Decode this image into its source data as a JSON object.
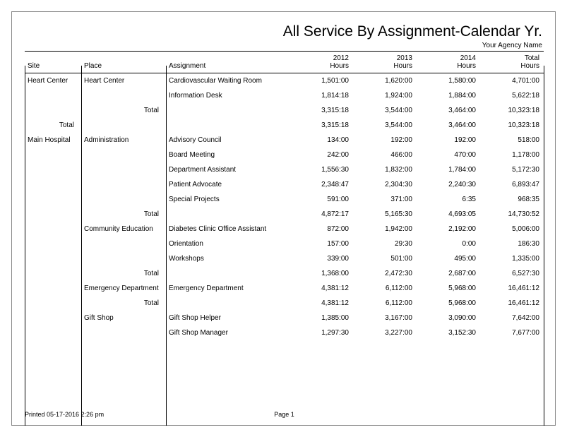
{
  "title": "All Service By Assignment-Calendar Yr.",
  "agency": "Your Agency Name",
  "headers": {
    "site": "Site",
    "place": "Place",
    "assignment": "Assignment",
    "y1a": "2012",
    "y1b": "Hours",
    "y2a": "2013",
    "y2b": "Hours",
    "y3a": "2014",
    "y3b": "Hours",
    "tota": "Total",
    "totb": "Hours"
  },
  "total_label": "Total",
  "rows": [
    {
      "site": "Heart Center",
      "place": "Heart Center",
      "assign": "Cardiovascular Waiting Room",
      "v1": "1,501:00",
      "v2": "1,620:00",
      "v3": "1,580:00",
      "vt": "4,701:00"
    },
    {
      "site": "",
      "place": "",
      "assign": "Information Desk",
      "v1": "1,814:18",
      "v2": "1,924:00",
      "v3": "1,884:00",
      "vt": "5,622:18"
    },
    {
      "placetotal": true,
      "v1": "3,315:18",
      "v2": "3,544:00",
      "v3": "3,464:00",
      "vt": "10,323:18"
    },
    {
      "sitetotal": true,
      "v1": "3,315:18",
      "v2": "3,544:00",
      "v3": "3,464:00",
      "vt": "10,323:18"
    },
    {
      "site": "Main Hospital",
      "place": "Administration",
      "assign": "Advisory Council",
      "v1": "134:00",
      "v2": "192:00",
      "v3": "192:00",
      "vt": "518:00"
    },
    {
      "site": "",
      "place": "",
      "assign": "Board Meeting",
      "v1": "242:00",
      "v2": "466:00",
      "v3": "470:00",
      "vt": "1,178:00"
    },
    {
      "site": "",
      "place": "",
      "assign": "Department Assistant",
      "v1": "1,556:30",
      "v2": "1,832:00",
      "v3": "1,784:00",
      "vt": "5,172:30"
    },
    {
      "site": "",
      "place": "",
      "assign": "Patient Advocate",
      "v1": "2,348:47",
      "v2": "2,304:30",
      "v3": "2,240:30",
      "vt": "6,893:47"
    },
    {
      "site": "",
      "place": "",
      "assign": "Special Projects",
      "v1": "591:00",
      "v2": "371:00",
      "v3": "6:35",
      "vt": "968:35"
    },
    {
      "placetotal": true,
      "v1": "4,872:17",
      "v2": "5,165:30",
      "v3": "4,693:05",
      "vt": "14,730:52"
    },
    {
      "site": "",
      "place": "Community Education",
      "assign": "Diabetes Clinic Office Assistant",
      "v1": "872:00",
      "v2": "1,942:00",
      "v3": "2,192:00",
      "vt": "5,006:00"
    },
    {
      "site": "",
      "place": "",
      "assign": "Orientation",
      "v1": "157:00",
      "v2": "29:30",
      "v3": "0:00",
      "vt": "186:30"
    },
    {
      "site": "",
      "place": "",
      "assign": "Workshops",
      "v1": "339:00",
      "v2": "501:00",
      "v3": "495:00",
      "vt": "1,335:00"
    },
    {
      "placetotal": true,
      "v1": "1,368:00",
      "v2": "2,472:30",
      "v3": "2,687:00",
      "vt": "6,527:30"
    },
    {
      "site": "",
      "place": "Emergency Department",
      "assign": "Emergency Department",
      "v1": "4,381:12",
      "v2": "6,112:00",
      "v3": "5,968:00",
      "vt": "16,461:12"
    },
    {
      "placetotal": true,
      "v1": "4,381:12",
      "v2": "6,112:00",
      "v3": "5,968:00",
      "vt": "16,461:12"
    },
    {
      "site": "",
      "place": "Gift Shop",
      "assign": "Gift Shop Helper",
      "v1": "1,385:00",
      "v2": "3,167:00",
      "v3": "3,090:00",
      "vt": "7,642:00"
    },
    {
      "site": "",
      "place": "",
      "assign": "Gift Shop Manager",
      "v1": "1,297:30",
      "v2": "3,227:00",
      "v3": "3,152:30",
      "vt": "7,677:00"
    }
  ],
  "footer": {
    "printed": "Printed 05-17-2016 2:26 pm",
    "page": "Page 1"
  },
  "chart_data": {
    "type": "table",
    "title": "All Service By Assignment-Calendar Yr.",
    "columns": [
      "Site",
      "Place",
      "Assignment",
      "2012 Hours",
      "2013 Hours",
      "2014 Hours",
      "Total Hours"
    ],
    "rows": [
      [
        "Heart Center",
        "Heart Center",
        "Cardiovascular Waiting Room",
        "1,501:00",
        "1,620:00",
        "1,580:00",
        "4,701:00"
      ],
      [
        "Heart Center",
        "Heart Center",
        "Information Desk",
        "1,814:18",
        "1,924:00",
        "1,884:00",
        "5,622:18"
      ],
      [
        "Heart Center",
        "Heart Center",
        "Total",
        "3,315:18",
        "3,544:00",
        "3,464:00",
        "10,323:18"
      ],
      [
        "Heart Center",
        "Total",
        "",
        "3,315:18",
        "3,544:00",
        "3,464:00",
        "10,323:18"
      ],
      [
        "Main Hospital",
        "Administration",
        "Advisory Council",
        "134:00",
        "192:00",
        "192:00",
        "518:00"
      ],
      [
        "Main Hospital",
        "Administration",
        "Board Meeting",
        "242:00",
        "466:00",
        "470:00",
        "1,178:00"
      ],
      [
        "Main Hospital",
        "Administration",
        "Department Assistant",
        "1,556:30",
        "1,832:00",
        "1,784:00",
        "5,172:30"
      ],
      [
        "Main Hospital",
        "Administration",
        "Patient Advocate",
        "2,348:47",
        "2,304:30",
        "2,240:30",
        "6,893:47"
      ],
      [
        "Main Hospital",
        "Administration",
        "Special Projects",
        "591:00",
        "371:00",
        "6:35",
        "968:35"
      ],
      [
        "Main Hospital",
        "Administration",
        "Total",
        "4,872:17",
        "5,165:30",
        "4,693:05",
        "14,730:52"
      ],
      [
        "Main Hospital",
        "Community Education",
        "Diabetes Clinic Office Assistant",
        "872:00",
        "1,942:00",
        "2,192:00",
        "5,006:00"
      ],
      [
        "Main Hospital",
        "Community Education",
        "Orientation",
        "157:00",
        "29:30",
        "0:00",
        "186:30"
      ],
      [
        "Main Hospital",
        "Community Education",
        "Workshops",
        "339:00",
        "501:00",
        "495:00",
        "1,335:00"
      ],
      [
        "Main Hospital",
        "Community Education",
        "Total",
        "1,368:00",
        "2,472:30",
        "2,687:00",
        "6,527:30"
      ],
      [
        "Main Hospital",
        "Emergency Department",
        "Emergency Department",
        "4,381:12",
        "6,112:00",
        "5,968:00",
        "16,461:12"
      ],
      [
        "Main Hospital",
        "Emergency Department",
        "Total",
        "4,381:12",
        "6,112:00",
        "5,968:00",
        "16,461:12"
      ],
      [
        "Main Hospital",
        "Gift Shop",
        "Gift Shop Helper",
        "1,385:00",
        "3,167:00",
        "3,090:00",
        "7,642:00"
      ],
      [
        "Main Hospital",
        "Gift Shop",
        "Gift Shop Manager",
        "1,297:30",
        "3,227:00",
        "3,152:30",
        "7,677:00"
      ]
    ]
  }
}
